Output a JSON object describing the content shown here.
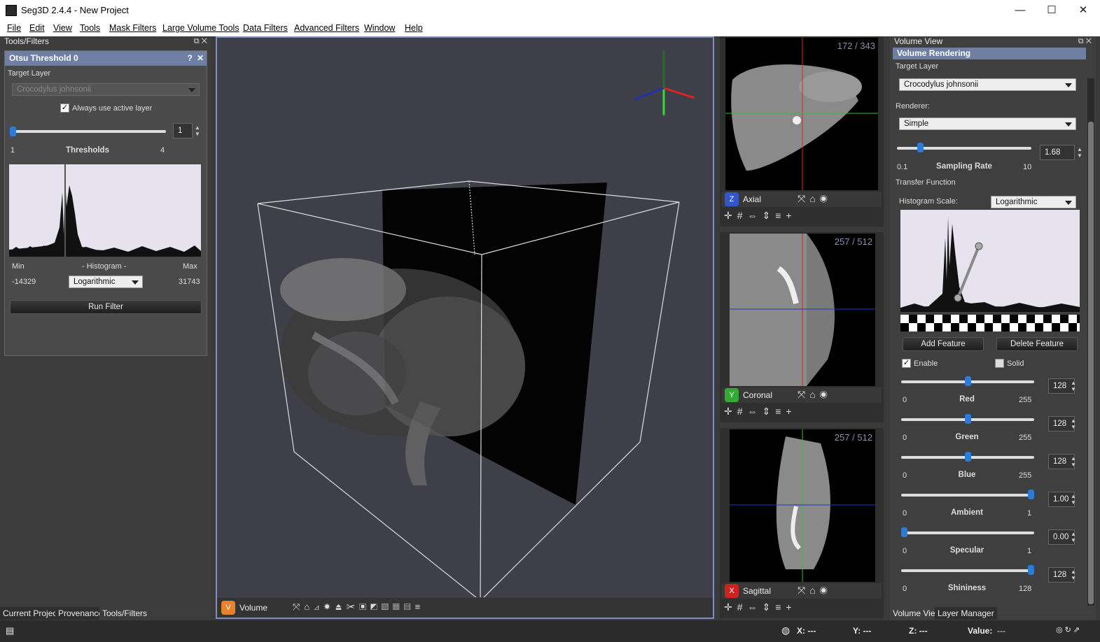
{
  "window": {
    "title": "Seg3D 2.4.4 - New Project",
    "minimize": "—",
    "maximize": "☐",
    "close": "✕"
  },
  "menu": [
    "File",
    "Edit",
    "View",
    "Tools",
    "Mask Filters",
    "Large Volume Tools",
    "Data Filters",
    "Advanced Filters",
    "Window",
    "Help"
  ],
  "left_panel": {
    "dock_title": "Tools/Filters",
    "tool": {
      "title": "Otsu Threshold 0",
      "help": "?",
      "target_layer_label": "Target Layer",
      "target_layer_value": "Crocodylus johnsonii",
      "always_active_label": "Always use active layer",
      "always_active_checked": true,
      "thresholds_value": "1",
      "thresholds_min": "1",
      "thresholds_max": "4",
      "thresholds_label": "Thresholds",
      "hist_min_label": "Min",
      "hist_label": "- Histogram -",
      "hist_max_label": "Max",
      "hist_min_value": "-14329",
      "hist_scale": "Logarithmic",
      "hist_max_value": "31743",
      "run_button": "Run Filter"
    },
    "tabs": [
      "Current Project",
      "Provenance",
      "Tools/Filters"
    ]
  },
  "viewer3d": {
    "badge": "V",
    "label": "Volume",
    "badge_color": "#e8812a"
  },
  "slice_views": [
    {
      "badge": "Z",
      "label": "Axial",
      "counter": "172 / 343",
      "badge_color": "#3355cc"
    },
    {
      "badge": "Y",
      "label": "Coronal",
      "counter": "257 / 512",
      "badge_color": "#33aa33"
    },
    {
      "badge": "X",
      "label": "Sagittal",
      "counter": "257 / 512",
      "badge_color": "#cc2222"
    }
  ],
  "right_panel": {
    "dock_title": "Volume View",
    "section_title": "Volume Rendering",
    "target_layer_label": "Target Layer",
    "target_layer_value": "Crocodylus johnsonii",
    "renderer_label": "Renderer:",
    "renderer_value": "Simple",
    "sampling": {
      "value": "1.68",
      "min": "0.1",
      "max": "10",
      "label": "Sampling Rate",
      "level": 0.16
    },
    "transfer_label": "Transfer Function",
    "hist_scale_label": "Histogram Scale:",
    "hist_scale_value": "Logarithmic",
    "add_feature": "Add Feature",
    "delete_feature": "Delete Feature",
    "enable_label": "Enable",
    "enable_checked": true,
    "solid_label": "Solid",
    "solid_checked": false,
    "sliders": [
      {
        "label": "Red",
        "value": "128",
        "min": "0",
        "max": "255",
        "level": 0.5
      },
      {
        "label": "Green",
        "value": "128",
        "min": "0",
        "max": "255",
        "level": 0.5
      },
      {
        "label": "Blue",
        "value": "128",
        "min": "0",
        "max": "255",
        "level": 0.5
      },
      {
        "label": "Ambient",
        "value": "1.00",
        "min": "0",
        "max": "1",
        "level": 1.0
      },
      {
        "label": "Specular",
        "value": "0.00",
        "min": "0",
        "max": "1",
        "level": 0.0
      },
      {
        "label": "Shininess",
        "value": "128",
        "min": "0",
        "max": "128",
        "level": 1.0
      }
    ],
    "tabs": [
      "Volume View",
      "Layer Manager"
    ]
  },
  "status": {
    "x": "X: ---",
    "y": "Y: ---",
    "z": "Z: ---",
    "value_label": "Value:",
    "value": "---"
  }
}
